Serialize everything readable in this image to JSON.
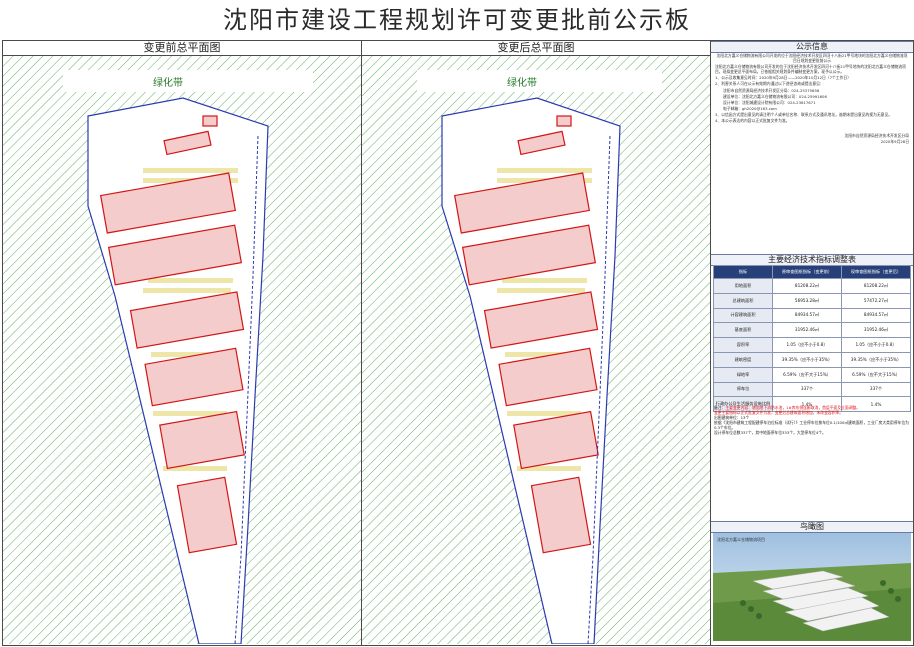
{
  "page": {
    "title": "沈阳市建设工程规划许可变更批前公示板"
  },
  "panels": {
    "before_title": "变更前总平面图",
    "after_title": "变更后总平面图",
    "road_label": "绿化带"
  },
  "notice": {
    "title": "公示信息",
    "heading": "沈阳北方嘉义仓储物流有限公司开发的位于沈阳经济技术开发区四河十八街21甲号地块的沈阳北方嘉义仓储物流项目日规划变更批前公示",
    "paragraphs": [
      "沈阳北方嘉义仓储物流有限公司开发的位于沈阳经济技术开发区四河十八街21甲号地块的沈阳北方嘉义仓储物流项目，现拟变更总平面布局，已依据相关规划条件编制变更方案，现予以公示。",
      "1、公示及收集意见时间：2020年9月28日——2020年10月12日（7个工作日）",
      "2、利害关系人可在公示有效期内通过以下途径咨询或提出意见：",
      "沈阳市自然资源局经济技术开发区分局：024-25375656",
      "建设单位：沈阳北方嘉义仓储物流有限公司：024-25991606",
      "设计单位：沈阳城建设计院有限公司：024-23617671",
      "电子邮箱：gh2020@163.com",
      "3、以信函方式提出意见的请注明个人或单位名称、联系方式及通讯地址，逾期未提出意见的视为无意见。",
      "4、本公示表达的内容以正式批复文件为准。"
    ],
    "footer_org": "沈阳市自然资源局经济技术开发区分局",
    "footer_date": "2020年9月28日"
  },
  "econ": {
    "title": "主要经济技术指标调整表",
    "headers": [
      "指标",
      "原审查图纸指标（变更前）",
      "现审查图纸指标（变更后）"
    ],
    "rows": [
      [
        "用地面积",
        "81208.22㎡",
        "81208.22㎡"
      ],
      [
        "总建筑面积",
        "56953.28㎡",
        "57472.27㎡"
      ],
      [
        "计容建筑面积",
        "84934.57㎡",
        "84934.57㎡"
      ],
      [
        "基底面积",
        "31952.46㎡",
        "31952.46㎡"
      ],
      [
        "容积率",
        "1.05（应不小于0.8）",
        "1.05（应不小于0.8）"
      ],
      [
        "建筑密度",
        "39.35%（应不小于35%）",
        "39.35%（应不小于35%）"
      ],
      [
        "绿地率",
        "6.59%（应不大于15%）",
        "6.59%（应不大于15%）"
      ],
      [
        "停车位",
        "337个",
        "337个"
      ],
      [
        "行政办公及生活服务设施比例",
        "1.4%",
        "1.4%"
      ]
    ]
  },
  "change_notes": {
    "line1_label": "备注：",
    "line1_text": "主要变更内容：增加地下消防水池，1#库东侧连廊取消，首层平面及立面调整。",
    "line2": "变更主要指标以正式批复文件为准，变更后总建筑面积增加，未改变容积率。",
    "line3": "出图建筑单位：13个",
    "line4": "依据《沈阳市建筑工程配建停车泊位标准（试行）》工业停车位按车位0.1/100㎡建筑面积，工业厂房大类用停车位为0.3个车位。",
    "line5": "设计停车位总数337个，其中地面停车位333个，大型停车位4个。"
  },
  "aerial": {
    "title": "鸟瞰图",
    "caption": "沈阳北方嘉义仓储物流项目"
  },
  "colors": {
    "building_fill": "#f4cccc",
    "building_edge": "#d31515",
    "hatch": "#3a9a3a",
    "boundary": "#2a3ab0",
    "table_header": "#27407a",
    "parking": "#eee5a8"
  }
}
